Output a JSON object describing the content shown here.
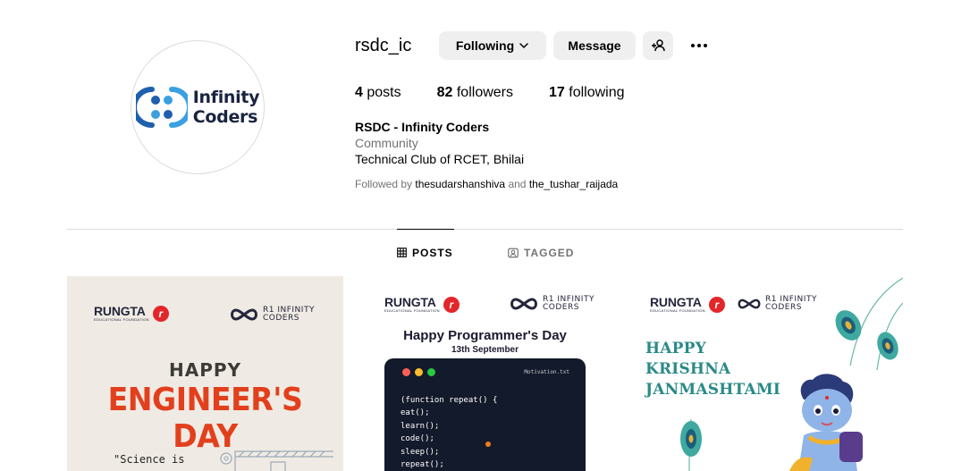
{
  "profile": {
    "username": "rsdc_ic",
    "full_name": "RSDC - Infinity Coders",
    "category": "Community",
    "bio": "Technical Club of RCET, Bhilai",
    "avatar_text": {
      "line1": "Infinity",
      "line2": "Coders"
    },
    "followed_by": {
      "prefix": "Followed by",
      "user1": "thesudarshanshiva",
      "conjunction": "and",
      "user2": "the_tushar_raijada"
    }
  },
  "actions": {
    "following_label": "Following",
    "message_label": "Message"
  },
  "stats": {
    "posts_count": "4",
    "posts_label": "posts",
    "followers_count": "82",
    "followers_label": "followers",
    "following_count": "17",
    "following_label": "following"
  },
  "tabs": {
    "posts": "POSTS",
    "tagged": "TAGGED"
  },
  "posts": [
    {
      "brand_left": "RUNGTA",
      "brand_left_sub": "EDUCATIONAL FOUNDATION",
      "brand_right_line1": "R1 INFINITY",
      "brand_right_line2": "CODERS",
      "line1": "HAPPY",
      "line2": "ENGINEER'S DAY",
      "quote": "\"Science is"
    },
    {
      "brand_left": "RUNGTA",
      "brand_left_sub": "EDUCATIONAL FOUNDATION",
      "brand_right_line1": "R1 INFINITY",
      "brand_right_line2": "CODERS",
      "title": "Happy Programmer's Day",
      "date": "13th September",
      "file_name": "Motivation.txt",
      "code": [
        "(function repeat() {",
        "eat();",
        "learn();",
        "code();",
        "sleep();",
        "repeat();"
      ]
    },
    {
      "brand_left": "RUNGTA",
      "brand_left_sub": "EDUCATIONAL FOUNDATION",
      "brand_right_line1": "R1 INFINITY",
      "brand_right_line2": "CODERS",
      "lines": [
        "HAPPY",
        "KRISHNA",
        "JANMASHTAMI"
      ]
    }
  ],
  "icons": {
    "following": "chevron-down-icon",
    "add_user": "add-user-icon",
    "more": "more-options-icon",
    "posts_tab": "grid-icon",
    "tagged_tab": "tagged-icon"
  },
  "colors": {
    "button_bg": "#efefef",
    "muted_text": "#737373",
    "divider": "#dbdbdb",
    "engineer_orange": "#e2401d",
    "krishna_teal": "#2a8a88"
  }
}
